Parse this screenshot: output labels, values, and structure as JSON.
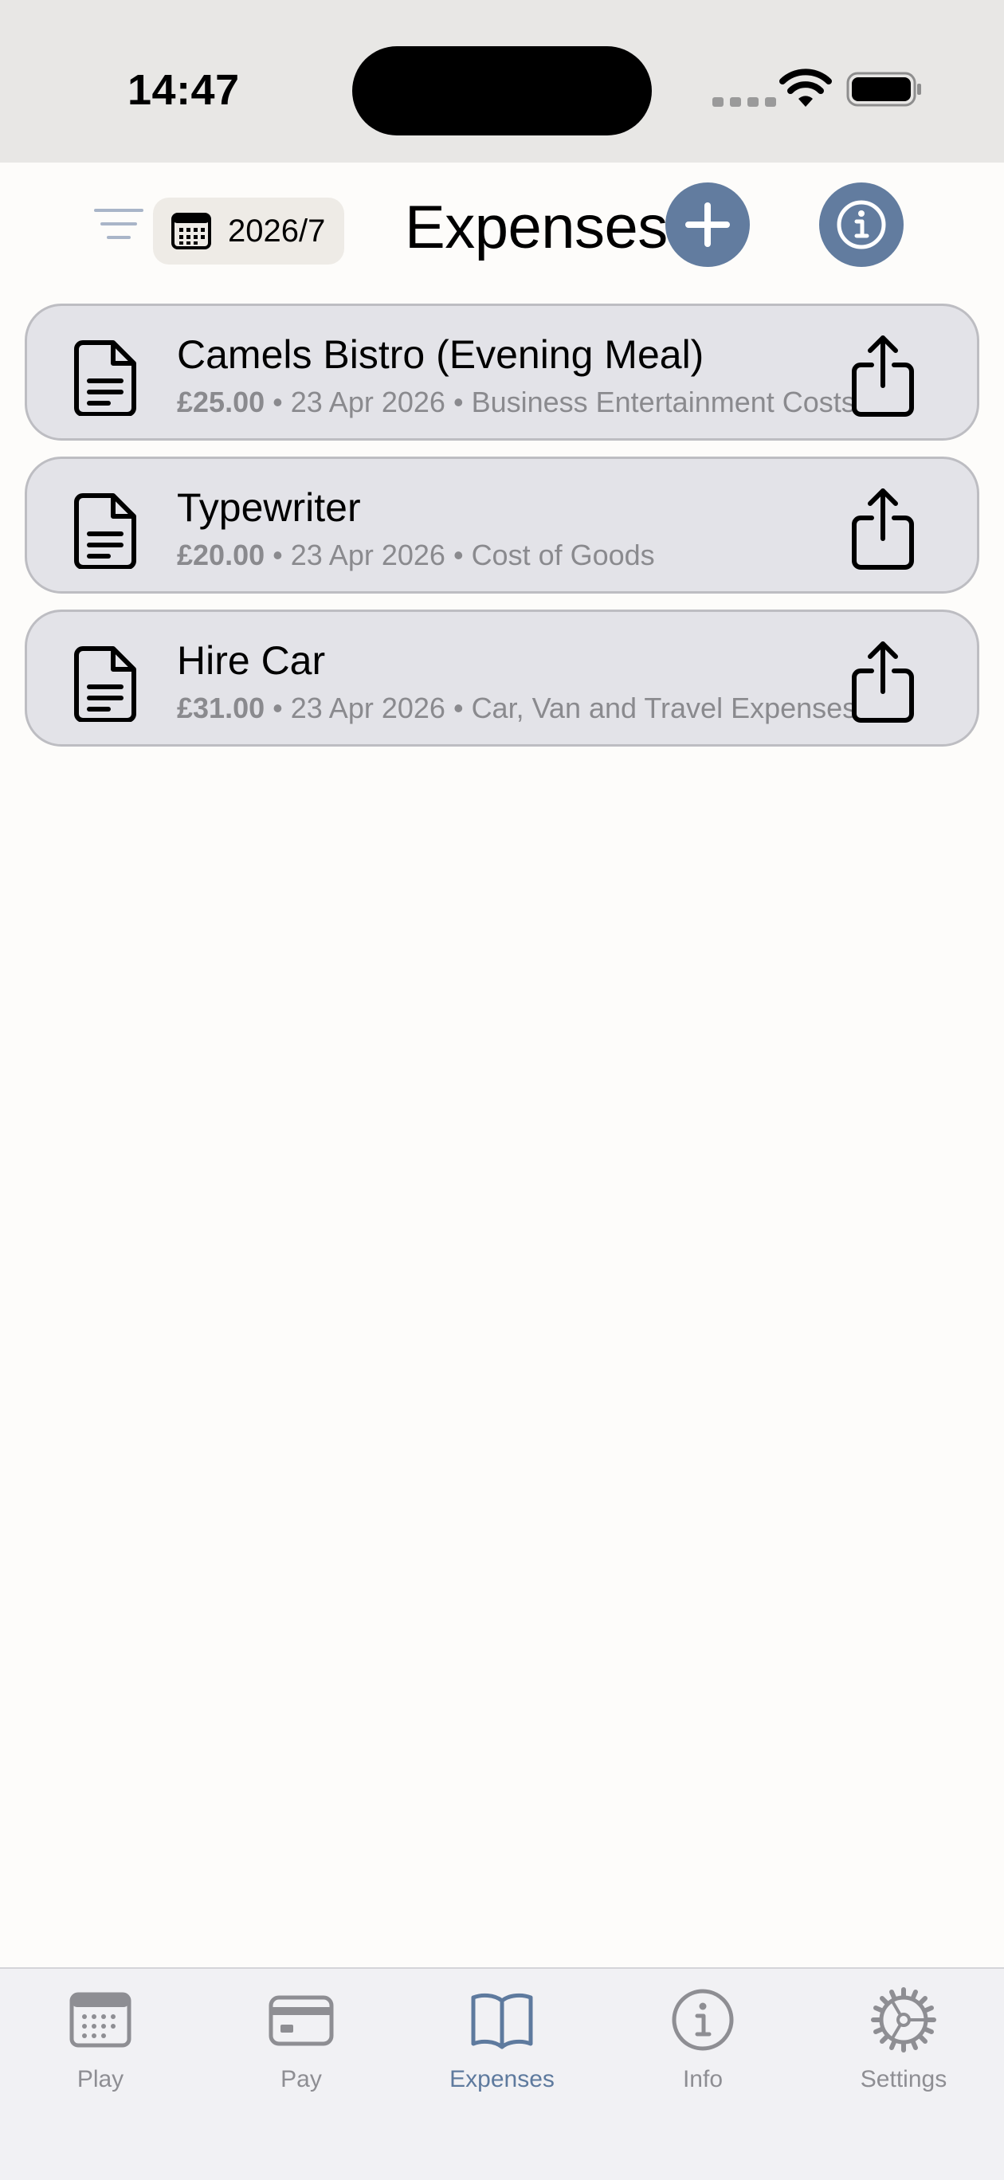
{
  "status_bar": {
    "time": "14:47"
  },
  "header": {
    "date_filter": "2026/7",
    "title": "Expenses",
    "accent_color": "#627C9F",
    "icons": [
      "filter-lines-icon",
      "calendar-icon",
      "plus-icon",
      "info-icon"
    ]
  },
  "expenses": [
    {
      "title": "Camels Bistro (Evening Meal)",
      "amount": "£25.00",
      "separator": "•",
      "date": "23 Apr 2026",
      "category": "Business Entertainment Costs"
    },
    {
      "title": "Typewriter",
      "amount": "£20.00",
      "separator": "•",
      "date": "23 Apr 2026",
      "category": "Cost of Goods"
    },
    {
      "title": "Hire Car",
      "amount": "£31.00",
      "separator": "•",
      "date": "23 Apr 2026",
      "category": "Car, Van and Travel Expenses"
    }
  ],
  "tab_bar": {
    "active_tab": "Expenses",
    "active_color": "#5E7A9E",
    "tabs": [
      {
        "label": "Play",
        "icon": "calendar-grid-icon"
      },
      {
        "label": "Pay",
        "icon": "credit-card-icon"
      },
      {
        "label": "Expenses",
        "icon": "open-book-icon"
      },
      {
        "label": "Info",
        "icon": "info-circle-icon"
      },
      {
        "label": "Settings",
        "icon": "gear-icon"
      }
    ]
  }
}
